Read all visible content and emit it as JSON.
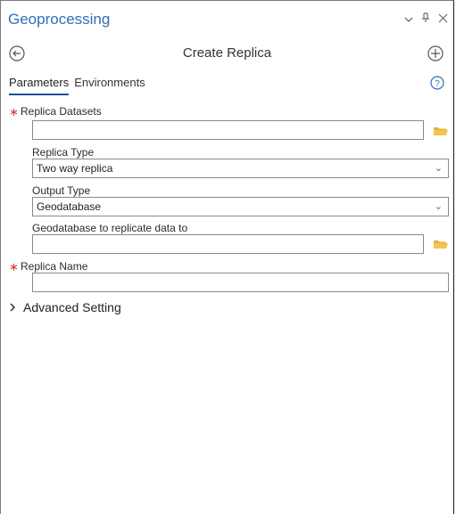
{
  "window": {
    "title": "Geoprocessing",
    "controls": {
      "dropdown": "⌄",
      "pin": "ꟼ",
      "close": "✕"
    }
  },
  "tool": {
    "title": "Create Replica"
  },
  "tabs": [
    {
      "label": "Parameters",
      "active": true
    },
    {
      "label": "Environments",
      "active": false
    }
  ],
  "params": {
    "replica_datasets": {
      "label": "Replica Datasets",
      "required": true,
      "value": ""
    },
    "replica_type": {
      "label": "Replica Type",
      "value": "Two way replica"
    },
    "output_type": {
      "label": "Output Type",
      "value": "Geodatabase"
    },
    "target_gdb": {
      "label": "Geodatabase to replicate data to",
      "value": ""
    },
    "replica_name": {
      "label": "Replica Name",
      "required": true,
      "value": ""
    }
  },
  "advanced": {
    "label": "Advanced Setting"
  },
  "colors": {
    "accent": "#2e6fb8",
    "required": "#d23a3a",
    "folder": "#e8b23a"
  }
}
